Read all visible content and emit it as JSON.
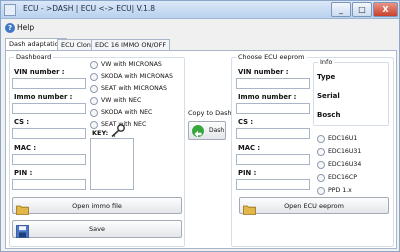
{
  "window": {
    "title": "ECU - >DASH | ECU <-> ECU|        V.1.8",
    "min": "_",
    "max": "□",
    "close": "X"
  },
  "menu": {
    "help": "Help",
    "help_icon": "?"
  },
  "tabs": [
    {
      "label": "Dash adaptation",
      "active": true
    },
    {
      "label": "ECU Clone",
      "active": false
    },
    {
      "label": "EDC 16 IMMO ON/OFF",
      "active": false
    }
  ],
  "dashboard": {
    "title": "Dashboard",
    "fields": {
      "vin": "VIN number :",
      "immo": "Immo number :",
      "cs": "CS :",
      "mac": "MAC :",
      "pin": "PIN :"
    },
    "dash_types": [
      "VW with MICRONAS",
      "SKODA with MICRONAS",
      "SEAT with MICRONAS",
      "VW with NEC",
      "SKODA with NEC",
      "SEAT with NEC"
    ],
    "key_label": "KEY:",
    "open_button": "Open immo file",
    "save_button": "Save"
  },
  "copy": {
    "label": "Copy to Dash",
    "button": "Dash"
  },
  "ecu": {
    "title": "Choose ECU eeprom",
    "fields": {
      "vin": "VIN number :",
      "immo": "Immo number :",
      "cs": "CS :",
      "mac": "MAC :",
      "pin": "PIN :"
    },
    "info_title": "Info",
    "info_items": [
      "Type",
      "Serial",
      "Bosch"
    ],
    "ecu_types": [
      "EDC16U1",
      "EDC16U31",
      "EDC16U34",
      "EDC16CP",
      "PPD 1.x"
    ],
    "open_button": "Open ECU eeprom"
  },
  "colors": {
    "accent": "#38a83e",
    "folder": "#e1b64a",
    "save": "#4a78c9"
  }
}
